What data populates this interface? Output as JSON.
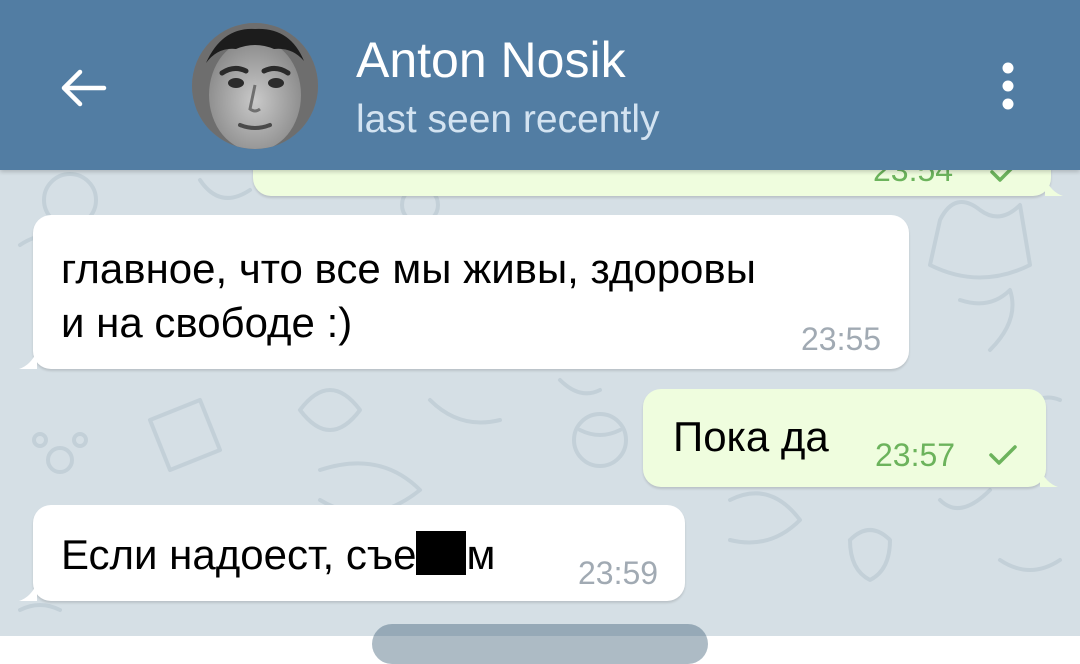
{
  "header": {
    "contact_name": "Anton Nosik",
    "status": "last seen recently",
    "back_icon": "arrow-left-icon",
    "menu_icon": "more-vertical-icon"
  },
  "messages": [
    {
      "direction": "outgoing",
      "text": "",
      "time": "23:54",
      "read": true
    },
    {
      "direction": "incoming",
      "lines": [
        "главное, что все мы живы, здоровы",
        "и на свободе :)"
      ],
      "time": "23:55"
    },
    {
      "direction": "outgoing",
      "text": "Пока да",
      "time": "23:57",
      "read": true
    },
    {
      "direction": "incoming",
      "text_before": "Если надоест, съе",
      "text_after": "м",
      "time": "23:59"
    }
  ],
  "colors": {
    "header": "#527da3",
    "chat_background": "#d5dfe5",
    "incoming_bubble": "#ffffff",
    "outgoing_bubble": "#effdde",
    "outgoing_time": "#6cb35c",
    "incoming_time": "#a1aab3"
  }
}
